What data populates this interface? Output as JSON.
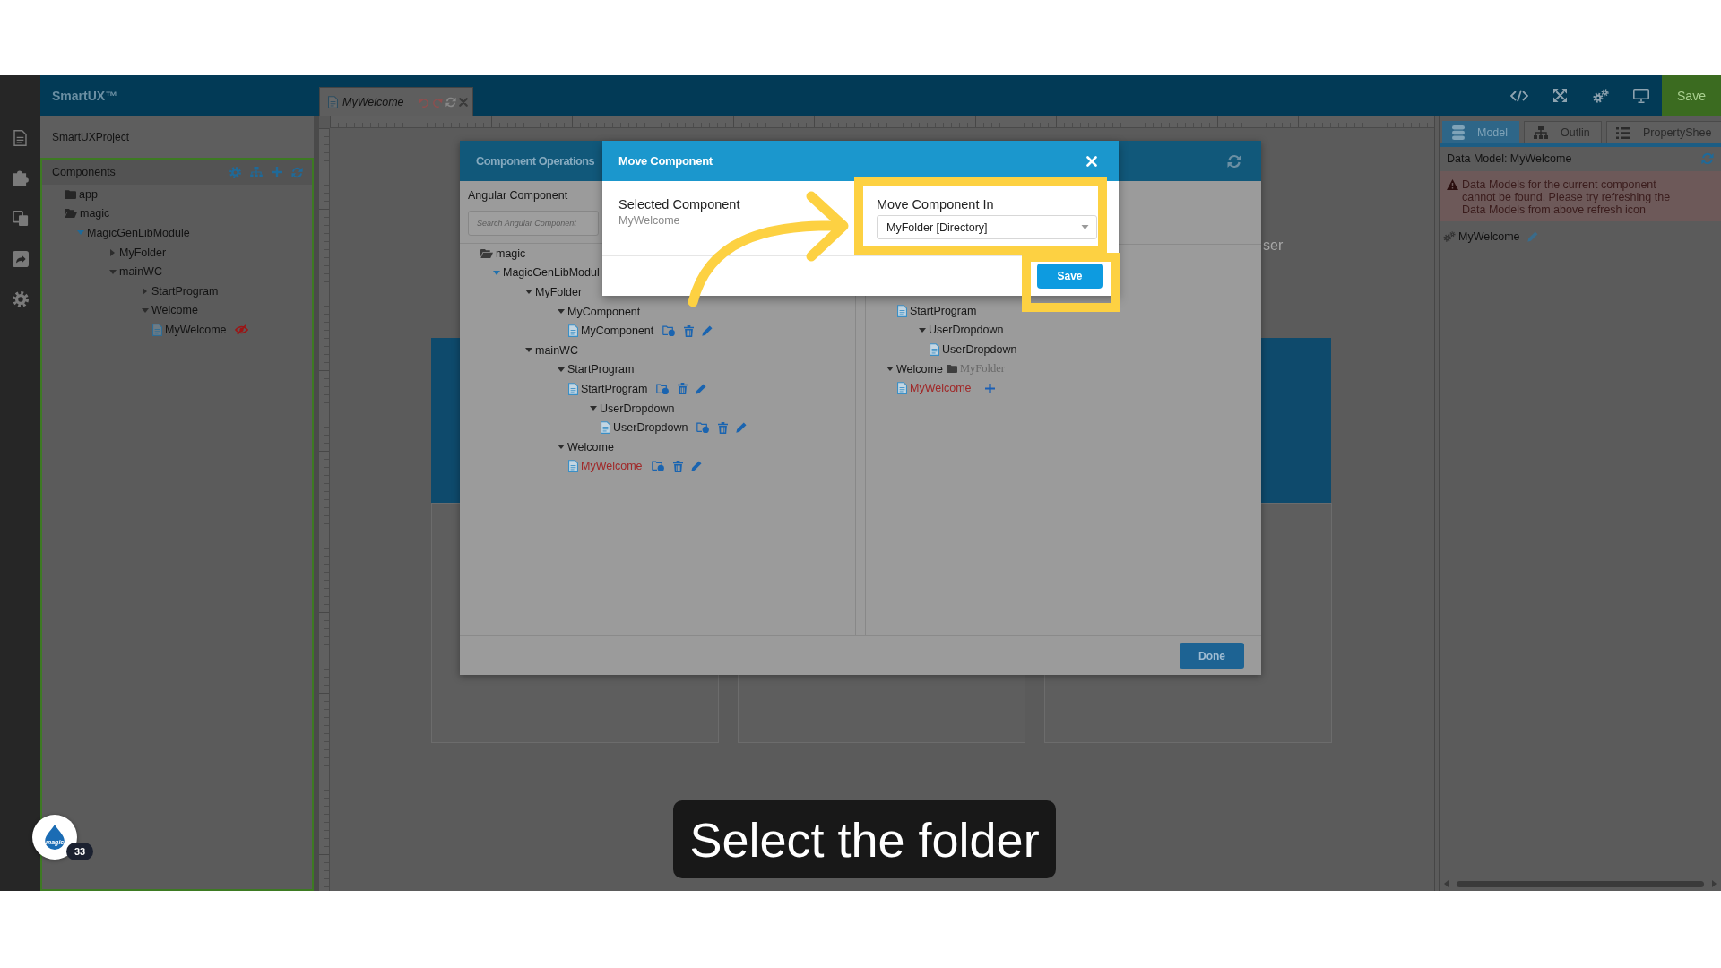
{
  "top_bar": {
    "title": "SmartUX™",
    "tabs": [
      {
        "label": "MyWelcome",
        "selected": true
      }
    ],
    "save_button": "Save"
  },
  "sidebar": {
    "project": "SmartUXProject",
    "section_title": "Components",
    "tree": [
      {
        "label": "app",
        "kind": "folder",
        "expanded": false
      },
      {
        "label": "magic",
        "kind": "folder",
        "expanded": true,
        "children": [
          {
            "label": "MagicGenLibModule",
            "kind": "node",
            "expanded": true,
            "children": [
              {
                "label": "MyFolder",
                "kind": "node",
                "expanded": false
              },
              {
                "label": "mainWC",
                "kind": "node",
                "expanded": true,
                "children": [
                  {
                    "label": "StartProgram",
                    "kind": "node",
                    "expanded": false
                  },
                  {
                    "label": "Welcome",
                    "kind": "node",
                    "expanded": true,
                    "children": [
                      {
                        "label": "MyWelcome",
                        "kind": "file",
                        "hidden": true
                      }
                    ]
                  }
                ]
              }
            ]
          }
        ]
      }
    ]
  },
  "canvas": {
    "partial_text": "ser"
  },
  "component_operations": {
    "title": "Component Operations",
    "source_label": "Angular Component",
    "search": {
      "placeholder": "Search Angular Component"
    },
    "source_tree": [
      {
        "label": "magic",
        "kind": "folder",
        "expanded": true,
        "children": [
          {
            "label": "MagicGenLibModul",
            "kind": "node",
            "expanded": true,
            "children": [
              {
                "label": "MyFolder",
                "kind": "node",
                "expanded": true,
                "children": [
                  {
                    "label": "MyComponent",
                    "kind": "node",
                    "expanded": true,
                    "children": [
                      {
                        "label": "MyComponent",
                        "kind": "file",
                        "selected": false
                      }
                    ]
                  }
                ]
              },
              {
                "label": "mainWC",
                "kind": "node",
                "expanded": true,
                "children": [
                  {
                    "label": "StartProgram",
                    "kind": "node",
                    "expanded": true,
                    "children": [
                      {
                        "label": "StartProgram",
                        "kind": "file",
                        "selected": false
                      },
                      {
                        "label": "UserDropdown",
                        "kind": "node",
                        "expanded": true,
                        "children": [
                          {
                            "label": "UserDropdown",
                            "kind": "file",
                            "selected": false
                          }
                        ]
                      }
                    ]
                  },
                  {
                    "label": "Welcome",
                    "kind": "node",
                    "expanded": true,
                    "children": [
                      {
                        "label": "MyWelcome",
                        "kind": "file",
                        "selected": true
                      }
                    ]
                  }
                ]
              }
            ]
          }
        ]
      }
    ],
    "target_tree_continued": [
      {
        "label": "StartProgram",
        "kind": "file",
        "selected": false
      },
      {
        "label": "UserDropdown",
        "kind": "node",
        "expanded": true,
        "children": [
          {
            "label": "UserDropdown",
            "kind": "file",
            "selected": false
          }
        ]
      }
    ],
    "target_tree": [
      {
        "label": "Welcome",
        "kind": "node",
        "expanded": true,
        "folder_tag": "MyFolder",
        "children": [
          {
            "label": "MyWelcome",
            "kind": "file",
            "selected": true
          }
        ]
      }
    ],
    "done_button": "Done"
  },
  "move_dialog": {
    "title": "Move Component",
    "selected_label": "Selected Component",
    "selected_value": "MyWelcome",
    "target_label": "Move Component In",
    "target_select": {
      "value": "MyFolder [Directory]"
    },
    "save_button": "Save"
  },
  "right_panel": {
    "tabs": [
      {
        "label": "Model",
        "selected": true
      },
      {
        "label": "Outlin",
        "selected": false
      },
      {
        "label": "PropertyShee",
        "selected": false
      }
    ],
    "title": "Data Model: MyWelcome",
    "warning": "Data Models for the current component cannot be found. Please try refreshing the Data Models from above refresh icon",
    "models": [
      {
        "label": "MyWelcome"
      }
    ]
  },
  "tutorial": {
    "caption": "Select the folder",
    "logo_text": "magic",
    "step_badge": "33"
  }
}
